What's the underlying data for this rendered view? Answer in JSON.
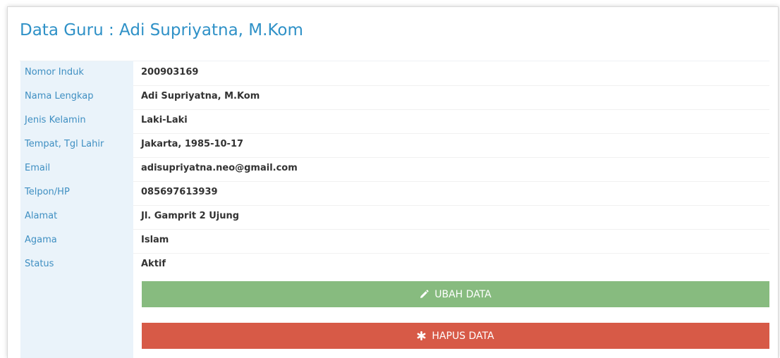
{
  "page": {
    "title": "Data Guru : Adi Supriyatna, M.Kom"
  },
  "fields": [
    {
      "label": "Nomor Induk",
      "value": "200903169"
    },
    {
      "label": "Nama Lengkap",
      "value": "Adi Supriyatna, M.Kom"
    },
    {
      "label": "Jenis Kelamin",
      "value": "Laki-Laki"
    },
    {
      "label": "Tempat, Tgl Lahir",
      "value": "Jakarta, 1985-10-17"
    },
    {
      "label": "Email",
      "value": "adisupriyatna.neo@gmail.com"
    },
    {
      "label": "Telpon/HP",
      "value": "085697613939"
    },
    {
      "label": "Alamat",
      "value": "Jl. Gamprit 2 Ujung"
    },
    {
      "label": "Agama",
      "value": "Islam"
    },
    {
      "label": "Status",
      "value": "Aktif"
    }
  ],
  "actions": {
    "edit_label": "UBAH DATA",
    "edit_icon": "pencil-icon",
    "delete_label": "HAPUS DATA",
    "delete_icon": "asterisk-icon"
  },
  "colors": {
    "title": "#2f91c7",
    "label_text": "#3f8fc2",
    "label_bg": "#eaf3fa",
    "edit_button": "#87bb7f",
    "delete_button": "#d75a47"
  }
}
